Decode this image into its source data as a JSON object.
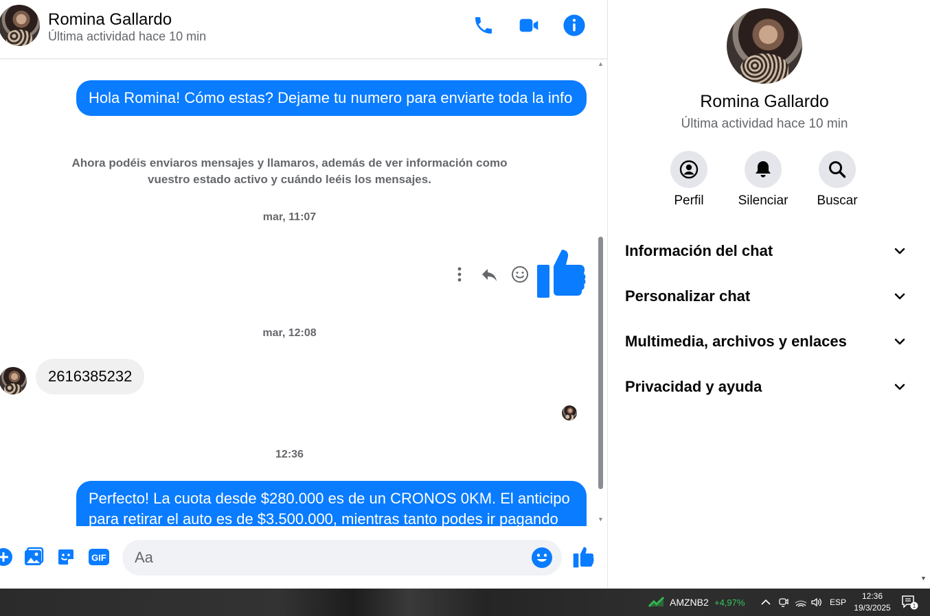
{
  "contact": {
    "name": "Romina Gallardo",
    "status": "Última actividad hace 10 min"
  },
  "messages": {
    "out_1": "Hola Romina! Cómo estas? Dejame tu numero para enviarte toda la info",
    "system_note": "Ahora podéis enviaros mensajes y llamaros, además de ver información como vuestro estado activo y cuándo leéis los mensajes.",
    "stamp_1": "mar, 11:07",
    "stamp_2": "mar, 12:08",
    "in_1": "2616385232",
    "stamp_3": "12:36",
    "out_2": "Perfecto! La cuota desde $280.000 es de un CRONOS 0KM. El anticipo para retirar el auto es de $3.500.000, mientras tanto podes ir pagando"
  },
  "composer": {
    "placeholder": "Aa"
  },
  "panel": {
    "actions": [
      {
        "label": "Perfil",
        "icon": "profile-icon"
      },
      {
        "label": "Silenciar",
        "icon": "bell-icon"
      },
      {
        "label": "Buscar",
        "icon": "search-icon"
      }
    ],
    "sections": [
      "Información del chat",
      "Personalizar chat",
      "Multimedia, archivos y enlaces",
      "Privacidad y ayuda"
    ]
  },
  "taskbar": {
    "stock_name": "AMZNB2",
    "stock_change": "+4,97%",
    "language": "ESP",
    "time": "12:36",
    "date": "19/3/2025",
    "notification_count": "1"
  },
  "colors": {
    "accent": "#0a7cff",
    "incoming_bubble": "#f0f0f0",
    "muted_text": "#65676b",
    "stock_up": "#35c759"
  }
}
